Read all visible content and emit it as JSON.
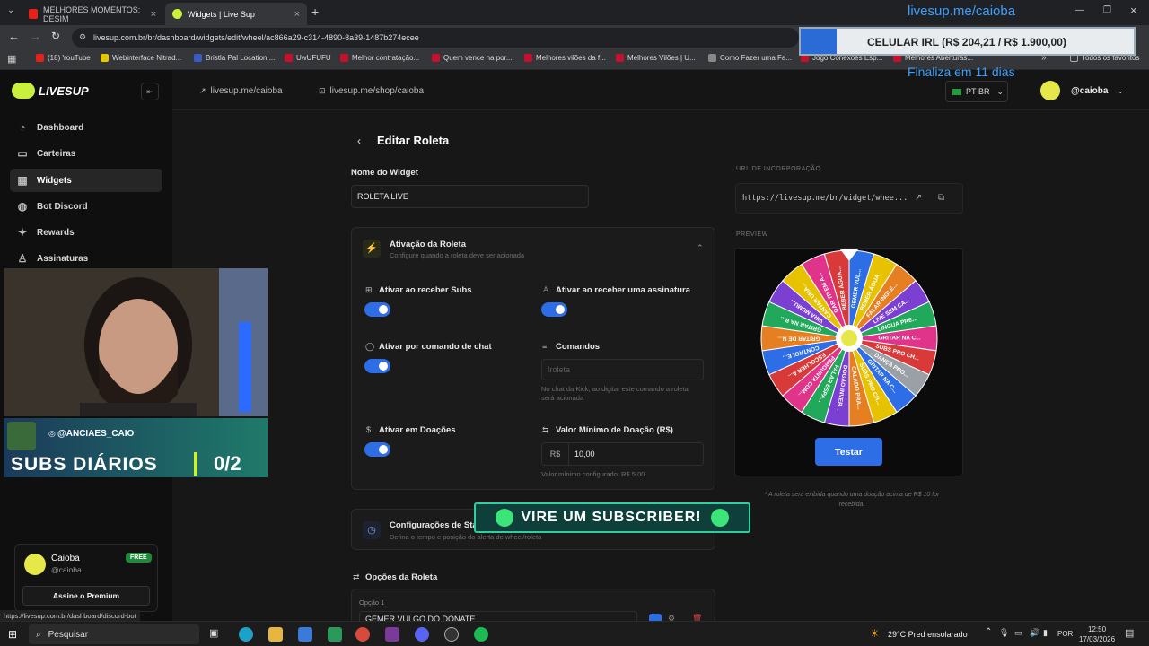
{
  "browser": {
    "tabs": [
      {
        "label": "MELHORES MOMENTOS: DESIM",
        "favicon_color": "#e62117"
      },
      {
        "label": "Widgets | Live Sup",
        "favicon_color": "#c8f03c"
      }
    ],
    "url": "livesup.com.br/br/dashboard/widgets/edit/wheel/ac866a29-c314-4890-8a39-1487b274ecee",
    "bookmarks": [
      "(18) YouTube",
      "Webinterface Nitrad...",
      "Bristla Pal Location,...",
      "UwUFUFU",
      "Melhor contratação...",
      "Quem vence na por...",
      "Melhores vilões da f...",
      "Melhores Vilões | U...",
      "Como Fazer uma Fa...",
      "Jogo Conexões Esp...",
      "Melhores Aberturas..."
    ],
    "bookmarks_all": "Todos os favoritos",
    "status_url": "https://livesup.com.br/dashboard/discord-bot"
  },
  "overlay": {
    "handle_top": "livesup.me/caioba",
    "goal_text": "CELULAR IRL (R$ 204,21 / R$ 1.900,00)",
    "goal_fraction": 0.107,
    "goal_ends": "Finaliza em 11 dias",
    "subs_user": "@ANCIAES_CAIO",
    "subs_title": "SUBS DIÁRIOS",
    "subs_count": "0/2",
    "banner": "VIRE UM SUBSCRIBER!"
  },
  "sidebar": {
    "brand": "LIVESUP",
    "items": [
      {
        "label": "Dashboard",
        "icon": "gauge-icon"
      },
      {
        "label": "Carteiras",
        "icon": "wallet-icon"
      },
      {
        "label": "Widgets",
        "icon": "grid-icon"
      },
      {
        "label": "Bot Discord",
        "icon": "discord-icon"
      },
      {
        "label": "Rewards",
        "icon": "sparkle-icon"
      },
      {
        "label": "Assinaturas",
        "icon": "user-icon"
      }
    ],
    "user": {
      "name": "Caioba",
      "handle": "@caioba",
      "plan": "FREE",
      "cta": "Assine o Premium"
    }
  },
  "topbar": {
    "link_profile": "livesup.me/caioba",
    "link_shop": "livesup.me/shop/caioba",
    "lang": "PT-BR",
    "user": "@caioba"
  },
  "form": {
    "title": "Editar Roleta",
    "name_label": "Nome do Widget",
    "name_value": "ROLETA LIVE",
    "activation": {
      "title": "Ativação da Roleta",
      "subtitle": "Configure quando a roleta deve ser acionada",
      "subs": "Ativar ao receber Subs",
      "signature": "Ativar ao receber uma assinatura",
      "chat": "Ativar por comando de chat",
      "commands": "Comandos",
      "commands_placeholder": "!roleta",
      "commands_help": "No chat da Kick, ao digitar este comando a roleta será acionada",
      "donations": "Ativar em Doações",
      "min_label": "Valor Mínimo de Doação (R$)",
      "currency": "R$",
      "min_value": "10,00",
      "min_help": "Valor mínimo configurado: R$ 5,00"
    },
    "config": {
      "title": "Configurações de Sta",
      "subtitle": "Defina o tempo e posição do alerta de wheel/roleta"
    },
    "options": {
      "title": "Opções da Roleta",
      "option_label": "Opção 1",
      "option_value": "GEMER VULGO DO DONATE"
    }
  },
  "preview": {
    "embed_label": "URL DE INCORPORAÇÃO",
    "embed_url": "https://livesup.me/br/widget/whee...",
    "preview_label": "PREVIEW",
    "test_button": "Testar",
    "note": "* A roleta será exibida quando uma doação acima de R$ 10 for recebida.",
    "wheel_labels": [
      "GEMER VUL...",
      "BEBER ÁGUA",
      "FALAR INGLE...",
      "LIVE SEM CA...",
      "LÍNGUA PRE...",
      "GRITAR NA C...",
      "SUBS PRO CH...",
      "DANÇA PRO...",
      "GRITAR NA C...",
      "SUBS PRO CH...",
      "CALADO PRA...",
      "DOGÃO INVER...",
      "FALAR ESPA...",
      "PERGUNTA COM...",
      "ESCOLHER A...",
      "CONTROLE...",
      "GRITAR DE N...",
      "GRITAR NA R...",
      "VIRA MUMU...",
      "CANTAR UMA...",
      "DAR TR EM A...",
      "BEBER ÁGUA..."
    ]
  },
  "taskbar": {
    "search": "Pesquisar",
    "weather": "29°C  Pred ensolarado",
    "lang": "POR",
    "time": "12:50",
    "date": "17/03/2026"
  }
}
